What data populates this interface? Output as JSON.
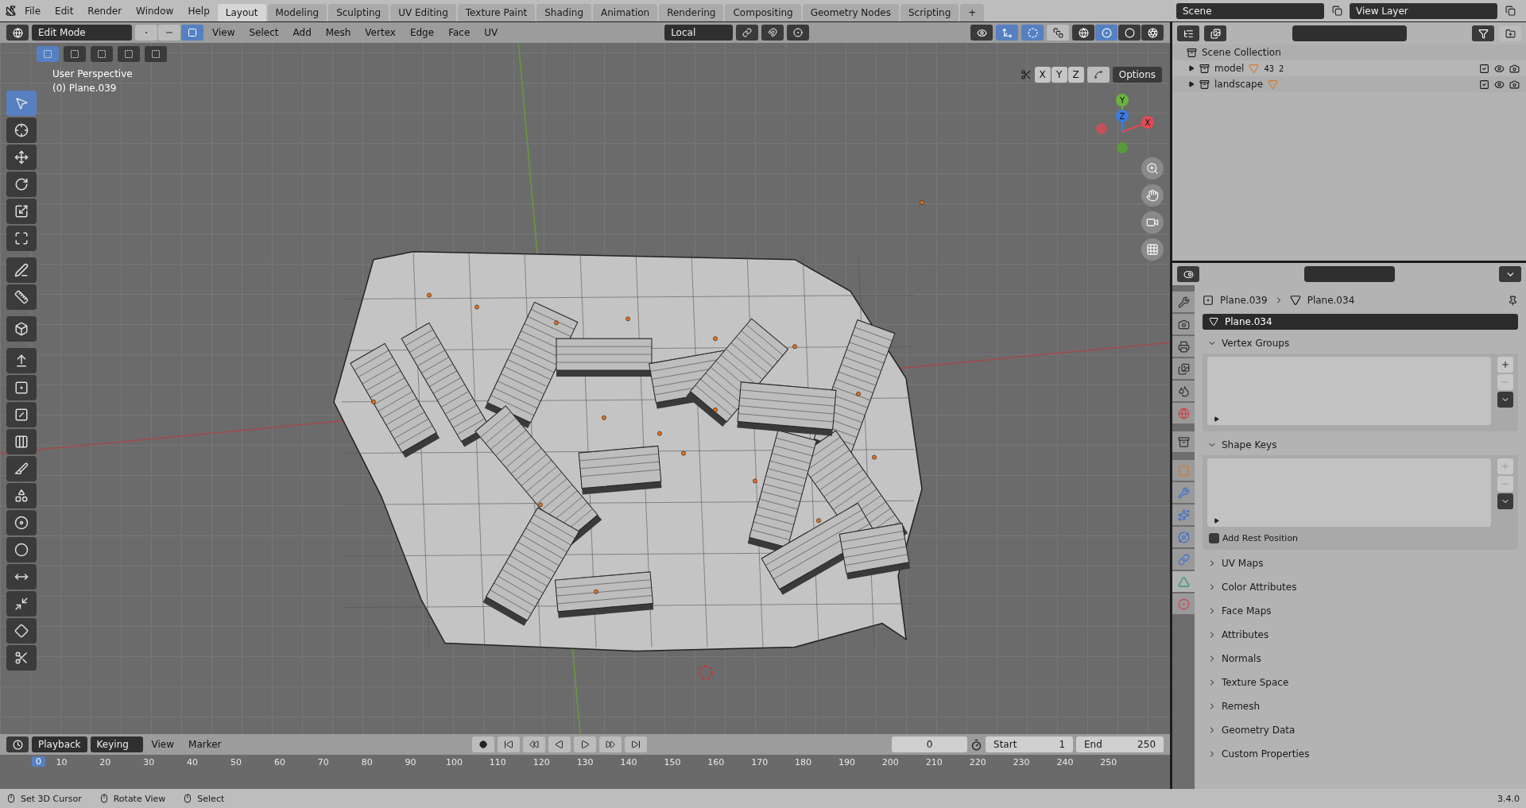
{
  "top_menu": [
    "File",
    "Edit",
    "Render",
    "Window",
    "Help"
  ],
  "workspaces": [
    {
      "label": "Layout",
      "selected": true
    },
    {
      "label": "Modeling",
      "selected": false
    },
    {
      "label": "Sculpting",
      "selected": false
    },
    {
      "label": "UV Editing",
      "selected": false
    },
    {
      "label": "Texture Paint",
      "selected": false
    },
    {
      "label": "Shading",
      "selected": false
    },
    {
      "label": "Animation",
      "selected": false
    },
    {
      "label": "Rendering",
      "selected": false
    },
    {
      "label": "Compositing",
      "selected": false
    },
    {
      "label": "Geometry Nodes",
      "selected": false
    },
    {
      "label": "Scripting",
      "selected": false
    }
  ],
  "add_workspace": "+",
  "scene": {
    "name": "Scene",
    "view_layer": "View Layer"
  },
  "viewport": {
    "mode": "Edit Mode",
    "select_modes": [
      {
        "kind": "vertex",
        "selected": false
      },
      {
        "kind": "edge",
        "selected": false
      },
      {
        "kind": "face",
        "selected": true
      }
    ],
    "menus": [
      "View",
      "Select",
      "Add",
      "Mesh",
      "Vertex",
      "Edge",
      "Face",
      "UV"
    ],
    "orientation": "Local",
    "shading": [
      {
        "kind": "wireframe",
        "selected": false
      },
      {
        "kind": "solid",
        "selected": true
      },
      {
        "kind": "material",
        "selected": false
      },
      {
        "kind": "rendered",
        "selected": false
      }
    ],
    "view_name": "User Perspective",
    "object_info": "(0) Plane.039",
    "mirror_axes": [
      {
        "label": "X",
        "selected": false
      },
      {
        "label": "Y",
        "selected": false
      },
      {
        "label": "Z",
        "selected": false
      }
    ],
    "options": "Options",
    "gizmo_axes": [
      "Y",
      "Z",
      "X"
    ],
    "tools": [
      {
        "kind": "select",
        "selected": true
      },
      {
        "kind": "cursor",
        "selected": false
      },
      {
        "kind": "move",
        "selected": false
      },
      {
        "kind": "rotate",
        "selected": false
      },
      {
        "kind": "scale",
        "selected": false
      },
      {
        "kind": "transform",
        "selected": false
      },
      {
        "kind": "annotate",
        "selected": false
      },
      {
        "kind": "measure",
        "selected": false
      },
      {
        "kind": "add-cube",
        "selected": false
      },
      {
        "kind": "extrude",
        "selected": false
      },
      {
        "kind": "inset",
        "selected": false
      },
      {
        "kind": "bevel",
        "selected": false
      },
      {
        "kind": "loop-cut",
        "selected": false
      },
      {
        "kind": "knife",
        "selected": false
      },
      {
        "kind": "poly-build",
        "selected": false
      },
      {
        "kind": "spin",
        "selected": false
      },
      {
        "kind": "smooth",
        "selected": false
      },
      {
        "kind": "edge-slide",
        "selected": false
      },
      {
        "kind": "shrink",
        "selected": false
      },
      {
        "kind": "shear",
        "selected": false
      },
      {
        "kind": "rip",
        "selected": false
      }
    ]
  },
  "outliner": {
    "root": "Scene Collection",
    "collections": [
      {
        "name": "model",
        "expanded": false,
        "counts": [
          "43",
          "2"
        ]
      },
      {
        "name": "landscape",
        "expanded": false
      }
    ]
  },
  "properties": {
    "object": "Plane.039",
    "mesh": "Plane.034",
    "datablock": "Plane.034",
    "tabs": [
      {
        "kind": "tool",
        "selected": false
      },
      {
        "kind": "render",
        "selected": false
      },
      {
        "kind": "output",
        "selected": false
      },
      {
        "kind": "view-layer",
        "selected": false
      },
      {
        "kind": "scene",
        "selected": false
      },
      {
        "kind": "world",
        "selected": false
      },
      {
        "kind": "collection",
        "selected": false
      },
      {
        "kind": "object",
        "selected": false
      },
      {
        "kind": "modifiers",
        "selected": false
      },
      {
        "kind": "particles",
        "selected": false
      },
      {
        "kind": "physics",
        "selected": false
      },
      {
        "kind": "constraints",
        "selected": false
      },
      {
        "kind": "data",
        "selected": true
      },
      {
        "kind": "material",
        "selected": false
      }
    ],
    "panels": [
      {
        "label": "Vertex Groups",
        "expanded": true
      },
      {
        "label": "Shape Keys",
        "expanded": true,
        "checkbox": {
          "label": "Add Rest Position",
          "checked": false
        }
      },
      {
        "label": "UV Maps",
        "expanded": false
      },
      {
        "label": "Color Attributes",
        "expanded": false
      },
      {
        "label": "Face Maps",
        "expanded": false
      },
      {
        "label": "Attributes",
        "expanded": false
      },
      {
        "label": "Normals",
        "expanded": false
      },
      {
        "label": "Texture Space",
        "expanded": false
      },
      {
        "label": "Remesh",
        "expanded": false
      },
      {
        "label": "Geometry Data",
        "expanded": false
      },
      {
        "label": "Custom Properties",
        "expanded": false
      }
    ]
  },
  "timeline": {
    "menus": [
      "Playback",
      "Keying",
      "View",
      "Marker"
    ],
    "current_frame": "0",
    "start_label": "Start",
    "start": "1",
    "end_label": "End",
    "end": "250",
    "playhead": "0",
    "ticks": [
      "10",
      "20",
      "30",
      "40",
      "50",
      "60",
      "70",
      "80",
      "90",
      "100",
      "110",
      "120",
      "130",
      "140",
      "150",
      "160",
      "170",
      "180",
      "190",
      "200",
      "210",
      "220",
      "230",
      "240",
      "250"
    ]
  },
  "status_bar": {
    "hints": [
      "Set 3D Cursor",
      "Rotate View",
      "Select"
    ],
    "version": "3.4.0"
  }
}
